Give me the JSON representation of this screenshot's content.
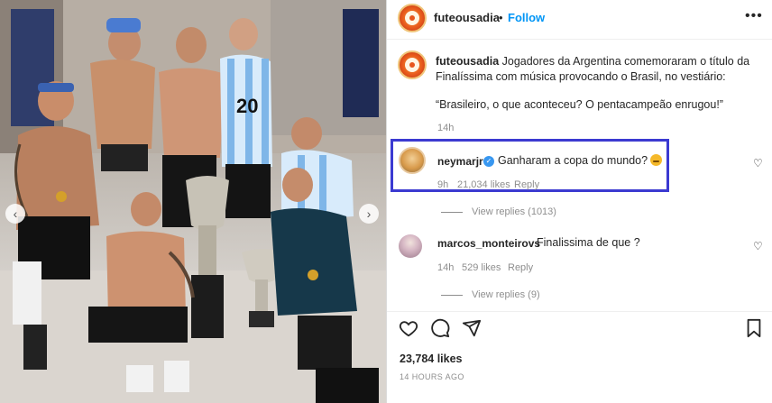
{
  "post": {
    "username": "futeousadia",
    "follow_label": "Follow",
    "more_icon": "more-icon"
  },
  "caption": {
    "username": "futeousadia",
    "text": " Jogadores da Argentina comemoraram o título da Finalíssima com música provocando o Brasil, no vestiário:",
    "quote": "“Brasileiro, o que aconteceu? O pentacampeão enrugou!”",
    "time": "14h"
  },
  "comments": [
    {
      "username": "neymarjr",
      "verified": true,
      "text": "Ganharam a copa do mundo?",
      "time": "9h",
      "likes": "21,034 likes",
      "reply_label": "Reply",
      "view_replies": "View replies (1013)"
    },
    {
      "username": "marcos_monteirovs",
      "text": "Finalissima de que ?",
      "time": "14h",
      "likes": "529 likes",
      "reply_label": "Reply",
      "view_replies": "View replies (9)"
    }
  ],
  "footer": {
    "likes": "23,784 likes",
    "time_ago": "14 HOURS AGO"
  },
  "colors": {
    "follow": "#0095f6",
    "highlight_border": "#3b3ad1",
    "muted": "#8e8e8e"
  }
}
